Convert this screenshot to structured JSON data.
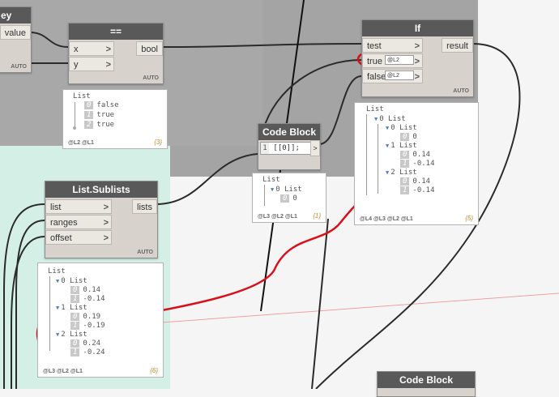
{
  "nodes": {
    "partial": {
      "header": "ey",
      "output": "value",
      "lacing": "AUTO"
    },
    "equals": {
      "header": "==",
      "inputs": [
        "x",
        "y"
      ],
      "output": "bool",
      "lacing": "AUTO"
    },
    "if": {
      "header": "If",
      "inputs": [
        "test",
        "true",
        "false"
      ],
      "output": "result",
      "lacing": "AUTO",
      "spinner": "@L2"
    },
    "code_block_1": {
      "header": "Code Block",
      "line_no": "1",
      "code": "[[0]];",
      "output": ">"
    },
    "sublists": {
      "header": "List.Sublists",
      "inputs": [
        "list",
        "ranges",
        "offset"
      ],
      "output": "lists",
      "lacing": "AUTO"
    },
    "code_block_2": {
      "header": "Code Block"
    }
  },
  "previews": {
    "equals": {
      "title": "List",
      "items": [
        {
          "idx": "0",
          "val": "false"
        },
        {
          "idx": "1",
          "val": "true"
        },
        {
          "idx": "2",
          "val": "true"
        }
      ],
      "levels": "@L2 @L1",
      "count": "{3}"
    },
    "code_block_1": {
      "title": "List",
      "sub_title": "0 List",
      "items": [
        {
          "idx": "0",
          "val": "0"
        }
      ],
      "levels": "@L3 @L2 @L1",
      "count": "{1}"
    },
    "if": {
      "title": "List",
      "sub_title": "0 List",
      "groups": [
        {
          "label": "0 List",
          "items": [
            {
              "idx": "0",
              "val": "0"
            }
          ]
        },
        {
          "label": "1 List",
          "items": [
            {
              "idx": "0",
              "val": "0.14"
            },
            {
              "idx": "1",
              "val": "-0.14"
            }
          ]
        },
        {
          "label": "2 List",
          "items": [
            {
              "idx": "0",
              "val": "0.14"
            },
            {
              "idx": "1",
              "val": "-0.14"
            }
          ]
        }
      ],
      "levels": "@L4 @L3 @L2 @L1",
      "count": "{5}"
    },
    "sublists": {
      "title": "List",
      "groups": [
        {
          "label": "0 List",
          "items": [
            {
              "idx": "0",
              "val": "0.14"
            },
            {
              "idx": "1",
              "val": "-0.14"
            }
          ]
        },
        {
          "label": "1 List",
          "items": [
            {
              "idx": "0",
              "val": "0.19"
            },
            {
              "idx": "1",
              "val": "-0.19"
            }
          ]
        },
        {
          "label": "2 List",
          "items": [
            {
              "idx": "0",
              "val": "0.24"
            },
            {
              "idx": "1",
              "val": "-0.24"
            }
          ]
        }
      ],
      "levels": "@L3 @L2 @L1",
      "count": "{6}"
    }
  },
  "annotation": {
    "question": "?"
  },
  "colors": {
    "wire": "#2b2b2b",
    "annotation": "#d9101a",
    "header": "#595959",
    "node_body": "#d7d3cc",
    "count": "#c98c2a"
  }
}
